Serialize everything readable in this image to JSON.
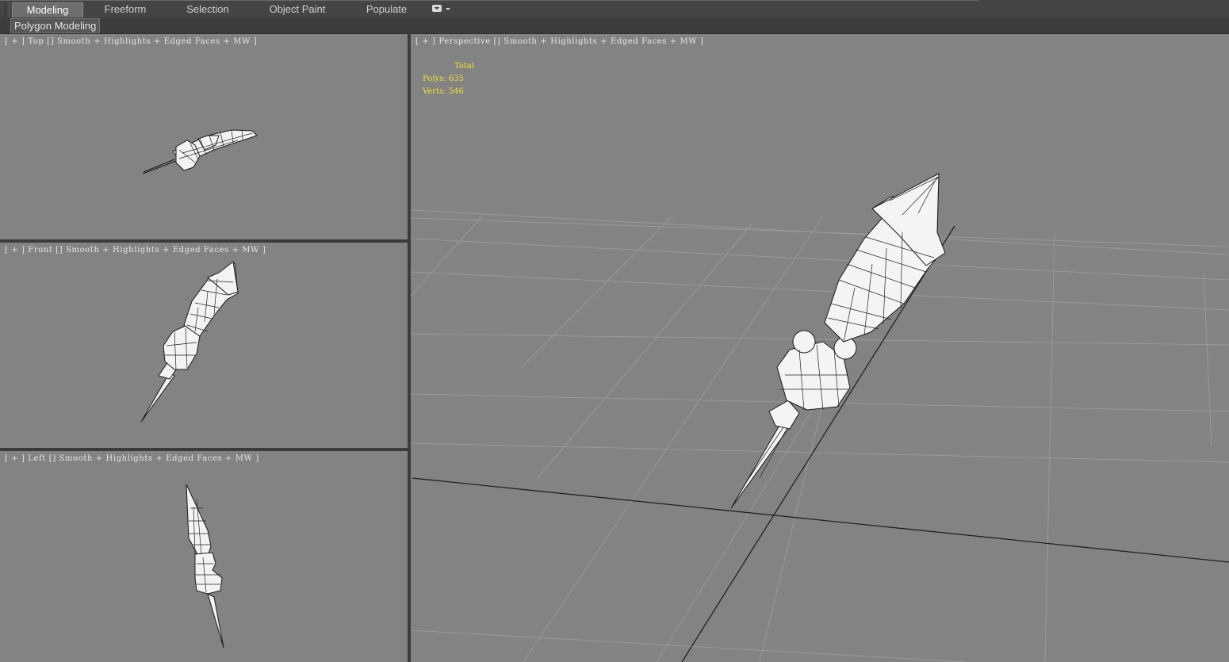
{
  "ribbon": {
    "tabs": [
      {
        "label": "Modeling",
        "active": true
      },
      {
        "label": "Freeform",
        "active": false
      },
      {
        "label": "Selection",
        "active": false
      },
      {
        "label": "Object Paint",
        "active": false
      },
      {
        "label": "Populate",
        "active": false
      }
    ],
    "options_icon": "dropdown-options-icon",
    "panel_label": "Polygon Modeling"
  },
  "viewports": {
    "top": {
      "label": "[ + ] Top [] Smooth + Highlights + Edged Faces + MW ]"
    },
    "front": {
      "label": "[ + ] Front [] Smooth + Highlights + Edged Faces + MW ]"
    },
    "left": {
      "label": "[ + ] Left [] Smooth + Highlights + Edged Faces + MW ]"
    },
    "perspective": {
      "label": "[ + ] Perspective [] Smooth + Highlights + Edged Faces + MW ]"
    }
  },
  "statistics": {
    "header": "Total",
    "polys_label": "Polys:",
    "polys_value": "635",
    "verts_label": "Verts:",
    "verts_value": "546"
  },
  "colors": {
    "viewport_bg": "#838383",
    "grid_line": "#9a9a9a",
    "stats_text": "#f0e236",
    "mesh_fill": "#f4f4f4",
    "wire": "#1a1a1a"
  }
}
